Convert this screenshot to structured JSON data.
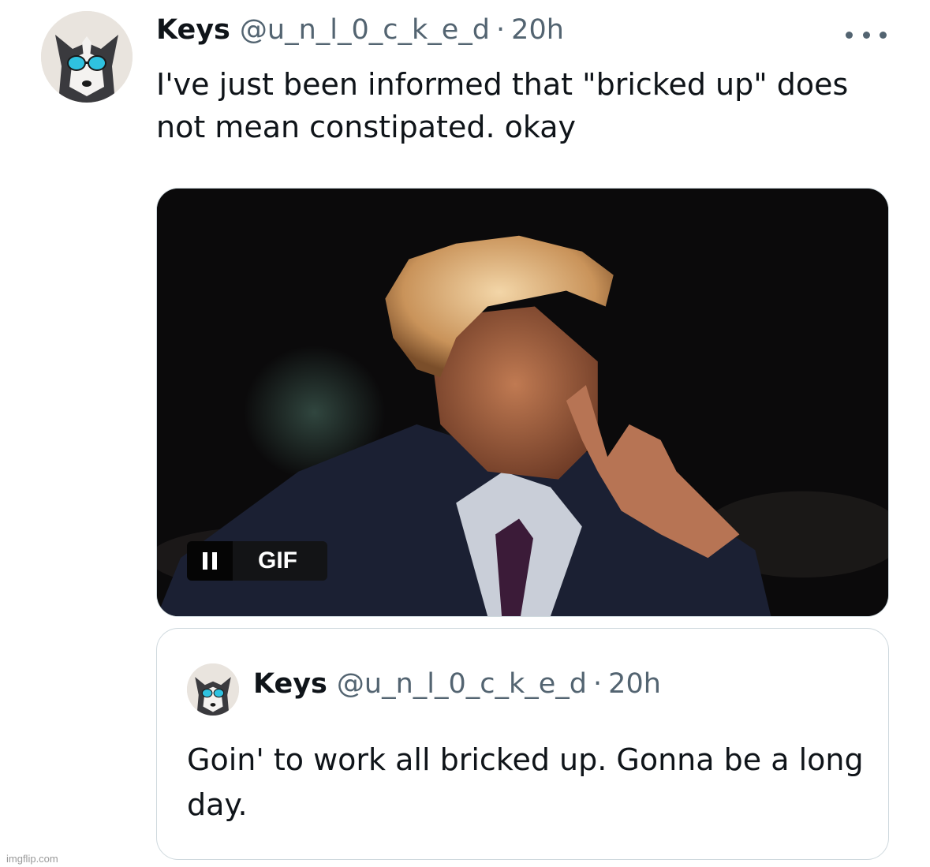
{
  "tweet": {
    "author_name": "Keys",
    "handle": "@u_n_l_0_c_k_e_d",
    "separator": "·",
    "time": "20h",
    "text": "I've just been informed that \"bricked up\" does not mean constipated. okay",
    "more_icon": "more-horizontal-icon",
    "avatar_icon": "husky-sunglasses-avatar"
  },
  "media": {
    "type": "gif",
    "badge_label": "GIF",
    "pause_icon": "pause-icon"
  },
  "quote": {
    "author_name": "Keys",
    "handle": "@u_n_l_0_c_k_e_d",
    "separator": "·",
    "time": "20h",
    "text": "Goin' to work all bricked up. Gonna be a long day."
  },
  "watermark": "imgflip.com",
  "colors": {
    "text_primary": "#0f1419",
    "text_secondary": "#536471",
    "border": "#cfd9de"
  }
}
